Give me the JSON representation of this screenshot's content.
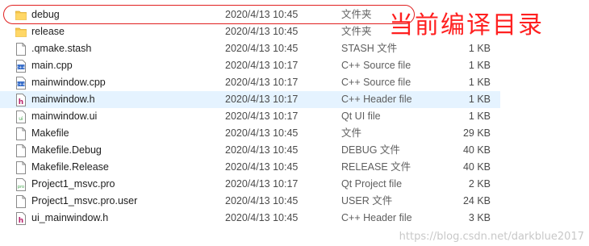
{
  "files": [
    {
      "name": "debug",
      "date": "2020/4/13 10:45",
      "type": "文件夹",
      "size": "",
      "icon": "folder-icon"
    },
    {
      "name": "release",
      "date": "2020/4/13 10:45",
      "type": "文件夹",
      "size": "",
      "icon": "folder-icon"
    },
    {
      "name": ".qmake.stash",
      "date": "2020/4/13 10:45",
      "type": "STASH 文件",
      "size": "1 KB",
      "icon": "file-icon"
    },
    {
      "name": "main.cpp",
      "date": "2020/4/13 10:17",
      "type": "C++ Source file",
      "size": "1 KB",
      "icon": "cpp-file-icon"
    },
    {
      "name": "mainwindow.cpp",
      "date": "2020/4/13 10:17",
      "type": "C++ Source file",
      "size": "1 KB",
      "icon": "cpp-file-icon"
    },
    {
      "name": "mainwindow.h",
      "date": "2020/4/13 10:17",
      "type": "C++ Header file",
      "size": "1 KB",
      "icon": "header-file-icon"
    },
    {
      "name": "mainwindow.ui",
      "date": "2020/4/13 10:17",
      "type": "Qt UI file",
      "size": "1 KB",
      "icon": "qt-ui-file-icon"
    },
    {
      "name": "Makefile",
      "date": "2020/4/13 10:45",
      "type": "文件",
      "size": "29 KB",
      "icon": "file-icon"
    },
    {
      "name": "Makefile.Debug",
      "date": "2020/4/13 10:45",
      "type": "DEBUG 文件",
      "size": "40 KB",
      "icon": "file-icon"
    },
    {
      "name": "Makefile.Release",
      "date": "2020/4/13 10:45",
      "type": "RELEASE 文件",
      "size": "40 KB",
      "icon": "file-icon"
    },
    {
      "name": "Project1_msvc.pro",
      "date": "2020/4/13 10:17",
      "type": "Qt Project file",
      "size": "2 KB",
      "icon": "qt-project-file-icon"
    },
    {
      "name": "Project1_msvc.pro.user",
      "date": "2020/4/13 10:45",
      "type": "USER 文件",
      "size": "24 KB",
      "icon": "file-icon"
    },
    {
      "name": "ui_mainwindow.h",
      "date": "2020/4/13 10:45",
      "type": "C++ Header file",
      "size": "3 KB",
      "icon": "header-file-icon"
    }
  ],
  "hover_row": "mainwindow.h",
  "annotation": "当前编译目录",
  "watermark": "https://blog.csdn.net/darkblue2017",
  "colors": {
    "annotation": "#ff2020",
    "hover_background": "#e5f3ff",
    "folder": "#f5c54b"
  }
}
